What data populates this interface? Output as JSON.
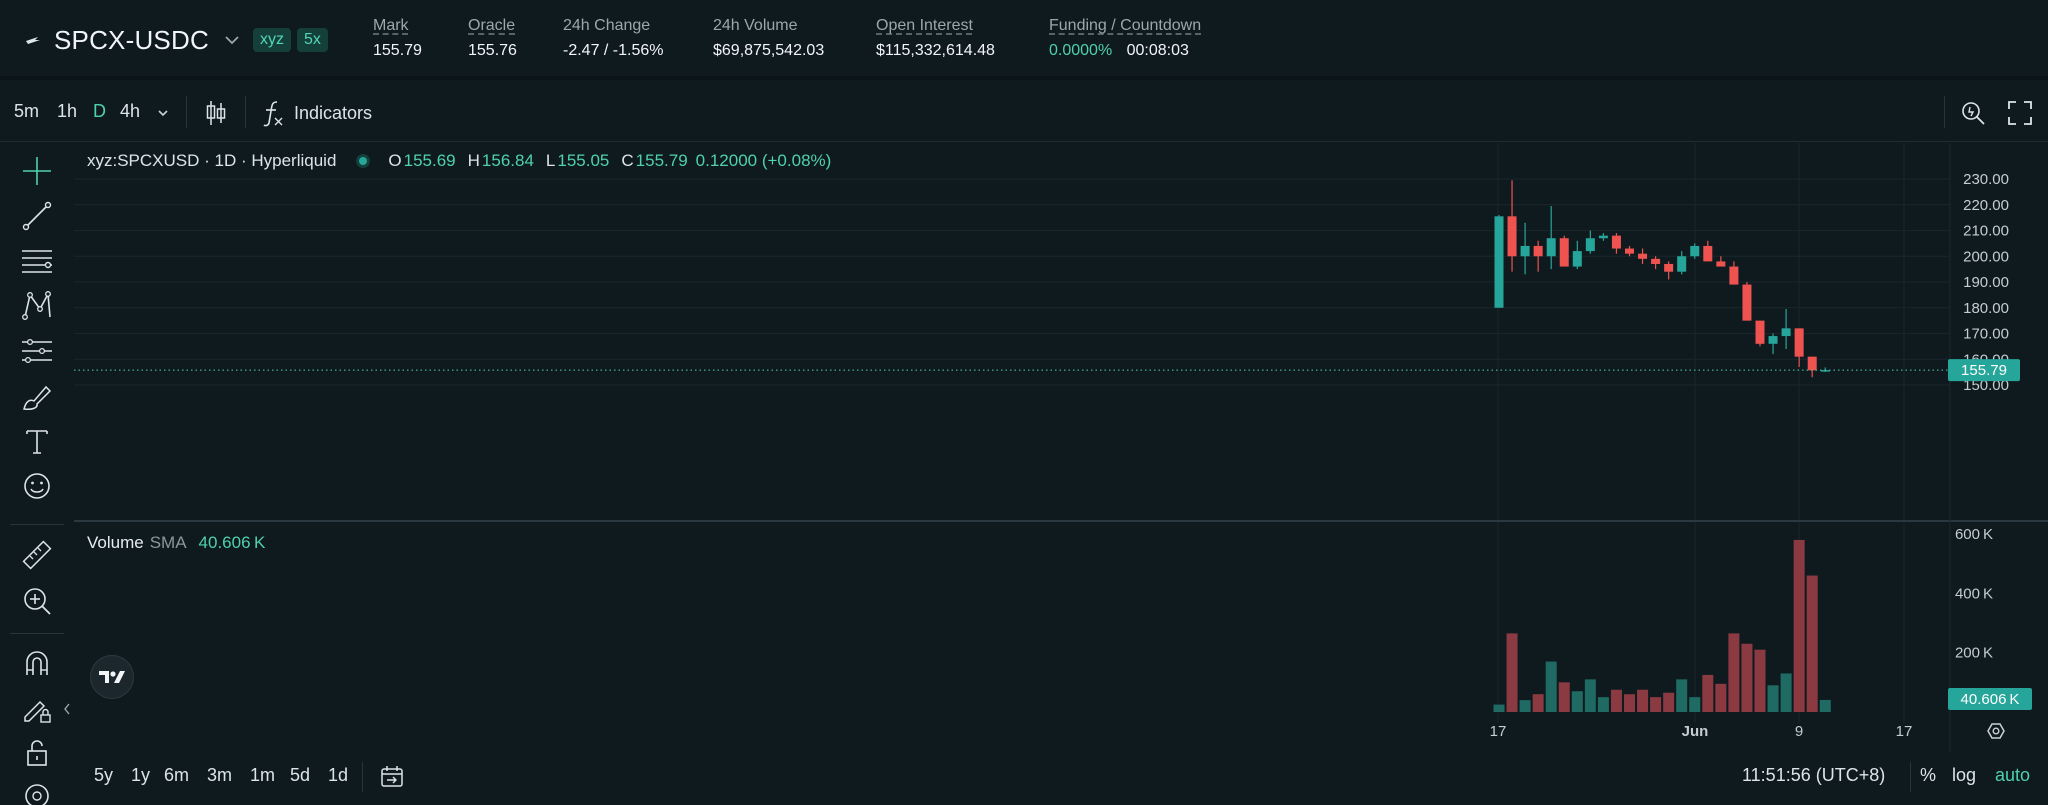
{
  "market": {
    "symbol": "SPCX-USDC",
    "badges": [
      "xyz",
      "5x"
    ],
    "mark_label": "Mark",
    "mark_value": "155.79",
    "oracle_label": "Oracle",
    "oracle_value": "155.76",
    "change_label": "24h Change",
    "change_value": "-2.47 / -1.56%",
    "volume_label": "24h Volume",
    "volume_value": "$69,875,542.03",
    "oi_label": "Open Interest",
    "oi_value": "$115,332,614.48",
    "funding_label": "Funding / Countdown",
    "funding_rate": "0.0000%",
    "countdown": "00:08:03"
  },
  "toolbar": {
    "timeframes": [
      "5m",
      "1h",
      "D",
      "4h"
    ],
    "active_timeframe": "D",
    "indicators_label": "Indicators"
  },
  "legend": {
    "title": "xyz:SPCXUSD · 1D · Hyperliquid",
    "o_key": "O",
    "o": "155.69",
    "h_key": "H",
    "h": "156.84",
    "l_key": "L",
    "l": "155.05",
    "c_key": "C",
    "c": "155.79",
    "change": "0.12000 (+0.08%)"
  },
  "volume_legend": {
    "name": "Volume",
    "sma": "SMA",
    "value": "40.606 K"
  },
  "bottom": {
    "ranges": [
      "5y",
      "1y",
      "6m",
      "3m",
      "1m",
      "5d",
      "1d"
    ],
    "clock": "11:51:56 (UTC+8)",
    "pct": "%",
    "log": "log",
    "auto": "auto"
  },
  "colors": {
    "up": "#26a69a",
    "down": "#ef5350",
    "accent": "#4fd1ad",
    "bg": "#0f1a1f"
  },
  "chart_data": {
    "type": "candlestick",
    "price_axis": {
      "min": 150,
      "max": 230,
      "ticks": [
        "230.00",
        "220.00",
        "210.00",
        "200.00",
        "190.00",
        "180.00",
        "170.00",
        "160.00",
        "150.00"
      ]
    },
    "last_price": "155.79",
    "time_axis": {
      "ticks": [
        "17",
        "Jun",
        "9",
        "17"
      ]
    },
    "volume_axis": {
      "ticks": [
        "600 K",
        "400 K",
        "200 K"
      ],
      "max": 650
    },
    "volume_last": "40.606 K",
    "candles": [
      {
        "o": 180,
        "h": 216,
        "l": 180,
        "c": 215.5,
        "v": 25
      },
      {
        "o": 215.5,
        "h": 229.5,
        "l": 194,
        "c": 200,
        "v": 265
      },
      {
        "o": 200,
        "h": 213,
        "l": 193,
        "c": 204,
        "v": 40
      },
      {
        "o": 204,
        "h": 206,
        "l": 194,
        "c": 200,
        "v": 60
      },
      {
        "o": 200,
        "h": 219.5,
        "l": 195,
        "c": 207,
        "v": 170
      },
      {
        "o": 207,
        "h": 208,
        "l": 196,
        "c": 196,
        "v": 100
      },
      {
        "o": 196,
        "h": 206,
        "l": 195,
        "c": 202,
        "v": 70
      },
      {
        "o": 202,
        "h": 210,
        "l": 201,
        "c": 207,
        "v": 110
      },
      {
        "o": 207,
        "h": 209,
        "l": 206,
        "c": 208,
        "v": 50
      },
      {
        "o": 208,
        "h": 209,
        "l": 201,
        "c": 203,
        "v": 75
      },
      {
        "o": 203,
        "h": 204,
        "l": 200,
        "c": 201,
        "v": 60
      },
      {
        "o": 201,
        "h": 203,
        "l": 197,
        "c": 199,
        "v": 75
      },
      {
        "o": 199,
        "h": 200,
        "l": 195,
        "c": 197,
        "v": 50
      },
      {
        "o": 197,
        "h": 198,
        "l": 191,
        "c": 194,
        "v": 65
      },
      {
        "o": 194,
        "h": 202,
        "l": 193,
        "c": 200,
        "v": 110
      },
      {
        "o": 200,
        "h": 205,
        "l": 199,
        "c": 204,
        "v": 50
      },
      {
        "o": 204,
        "h": 206,
        "l": 198,
        "c": 198,
        "v": 125
      },
      {
        "o": 198,
        "h": 200,
        "l": 196,
        "c": 196,
        "v": 95
      },
      {
        "o": 196,
        "h": 198,
        "l": 189,
        "c": 189,
        "v": 265
      },
      {
        "o": 189,
        "h": 190,
        "l": 175,
        "c": 175,
        "v": 230
      },
      {
        "o": 175,
        "h": 175,
        "l": 165,
        "c": 166,
        "v": 210
      },
      {
        "o": 166,
        "h": 170,
        "l": 162,
        "c": 169,
        "v": 90
      },
      {
        "o": 169,
        "h": 179.5,
        "l": 164,
        "c": 172,
        "v": 130
      },
      {
        "o": 172,
        "h": 172,
        "l": 157,
        "c": 161,
        "v": 580
      },
      {
        "o": 161,
        "h": 161,
        "l": 153,
        "c": 155.7,
        "v": 460
      },
      {
        "o": 155.69,
        "h": 156.84,
        "l": 155.05,
        "c": 155.79,
        "v": 40.6
      }
    ]
  }
}
